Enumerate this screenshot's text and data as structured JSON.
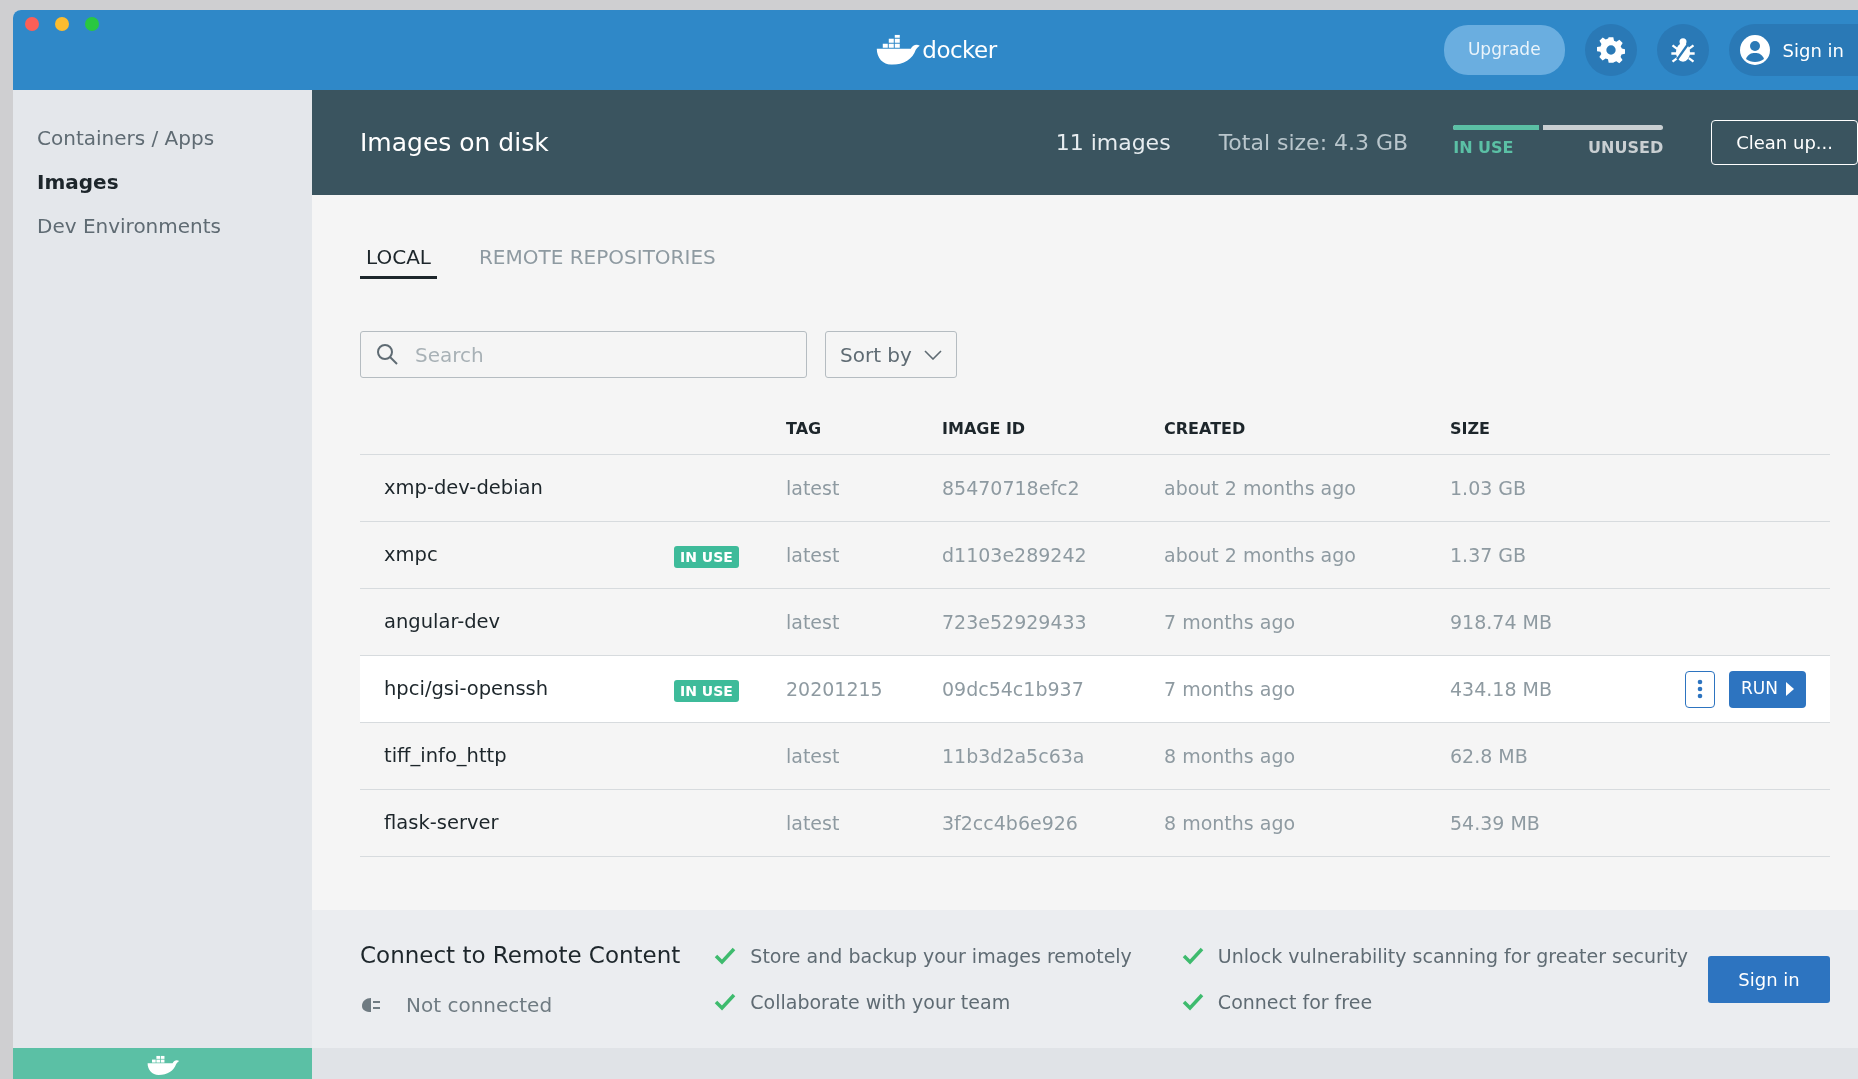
{
  "window": {
    "brand": "docker"
  },
  "topbar": {
    "upgrade": "Upgrade",
    "sign_in": "Sign in"
  },
  "sidebar": {
    "items": [
      {
        "label": "Containers / Apps",
        "selected": false
      },
      {
        "label": "Images",
        "selected": true
      },
      {
        "label": "Dev Environments",
        "selected": false
      }
    ]
  },
  "header": {
    "title": "Images on disk",
    "count": "11 images",
    "total_size": "Total size: 4.3 GB",
    "usage": {
      "level": 0.43,
      "in_use_label": "IN USE",
      "unused_label": "UNUSED"
    },
    "clean_up": "Clean up..."
  },
  "tabs": [
    {
      "label": "LOCAL",
      "selected": true
    },
    {
      "label": "REMOTE REPOSITORIES",
      "selected": false
    }
  ],
  "search": {
    "placeholder": "Search"
  },
  "sort": {
    "label": "Sort by"
  },
  "table": {
    "columns": [
      "TAG",
      "IMAGE ID",
      "CREATED",
      "SIZE"
    ],
    "run_label": "RUN",
    "rows": [
      {
        "name": "xmp-dev-debian",
        "in_use": false,
        "tag": "latest",
        "image_id": "85470718efc2",
        "created": "about 2 months ago",
        "size": "1.03 GB",
        "hovered": false
      },
      {
        "name": "xmpc",
        "in_use": true,
        "badge": "IN USE",
        "tag": "latest",
        "image_id": "d1103e289242",
        "created": "about 2 months ago",
        "size": "1.37 GB",
        "hovered": false
      },
      {
        "name": "angular-dev",
        "in_use": false,
        "tag": "latest",
        "image_id": "723e52929433",
        "created": "7 months ago",
        "size": "918.74 MB",
        "hovered": false
      },
      {
        "name": "hpci/gsi-openssh",
        "in_use": true,
        "badge": "IN USE",
        "tag": "20201215",
        "image_id": "09dc54c1b937",
        "created": "7 months ago",
        "size": "434.18 MB",
        "hovered": true
      },
      {
        "name": "tiff_info_http",
        "in_use": false,
        "tag": "latest",
        "image_id": "11b3d2a5c63a",
        "created": "8 months ago",
        "size": "62.8 MB",
        "hovered": false
      },
      {
        "name": "flask-server",
        "in_use": false,
        "tag": "latest",
        "image_id": "3f2cc4b6e926",
        "created": "8 months ago",
        "size": "54.39 MB",
        "hovered": false
      }
    ]
  },
  "remote": {
    "title": "Connect to Remote Content",
    "status": "Not connected",
    "features": [
      "Store and backup your images remotely",
      "Collaborate with your team",
      "Unlock vulnerability scanning for greater security",
      "Connect for free"
    ],
    "sign_in": "Sign in"
  }
}
